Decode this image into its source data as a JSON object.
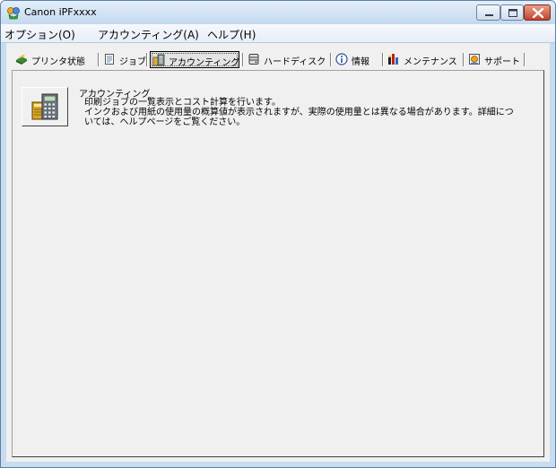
{
  "window": {
    "title": "Canon iPFxxxx"
  },
  "menu": {
    "items": [
      {
        "label": "オプション(O)"
      },
      {
        "label": "アカウンティング(A)"
      },
      {
        "label": "ヘルプ(H)"
      }
    ]
  },
  "tabs": {
    "items": [
      {
        "label": "プリンタ状態",
        "icon": "printer-status-icon"
      },
      {
        "label": "ジョブ",
        "icon": "job-icon"
      },
      {
        "label": "アカウンティング",
        "icon": "accounting-icon",
        "selected": true
      },
      {
        "label": "ハードディスク",
        "icon": "hard-disk-icon"
      },
      {
        "label": "情報",
        "icon": "info-icon"
      },
      {
        "label": "メンテナンス",
        "icon": "maintenance-icon"
      },
      {
        "label": "サポート",
        "icon": "support-icon"
      }
    ]
  },
  "accounting": {
    "button_icon": "accounting-calculator-icon",
    "title": "アカウンティング",
    "description_lines": [
      "印刷ジョブの一覧表示とコスト計算を行います。",
      "インクおよび用紙の使用量の概算値が表示されますが、実際の使用量とは異なる場合があります。詳細につ",
      "いては、ヘルプページをご覧ください。"
    ]
  }
}
